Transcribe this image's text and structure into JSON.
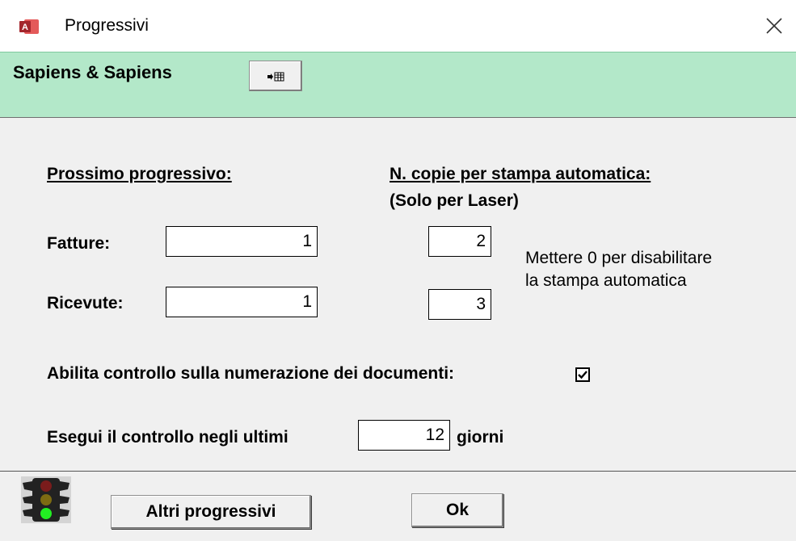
{
  "window": {
    "title": "Progressivi",
    "app_icon": "access-icon",
    "close_icon": "close-icon"
  },
  "header": {
    "company": "Sapiens & Sapiens",
    "button_icon": "arrow-table-icon",
    "background_color": "#b3e8c9"
  },
  "sections": {
    "progressivo_heading": "Prossimo progressivo:",
    "copie_heading": "N. copie per stampa automatica:",
    "copie_subheading": "(Solo per Laser)"
  },
  "rows": {
    "fatture_label": "Fatture:",
    "fatture_value": "1",
    "fatture_copies": "2",
    "ricevute_label": "Ricevute:",
    "ricevute_value": "1",
    "ricevute_copies": "3"
  },
  "hint": {
    "line1": "Mettere 0 per disabilitare",
    "line2": "la stampa automatica"
  },
  "check": {
    "label": "Abilita controllo sulla numerazione dei documenti:",
    "checked": true
  },
  "days": {
    "prefix": "Esegui il controllo negli ultimi",
    "value": "12",
    "suffix": "giorni"
  },
  "footer": {
    "traffic_icon": "traffic-light-icon",
    "altri_label": "Altri progressivi",
    "ok_label": "Ok"
  }
}
